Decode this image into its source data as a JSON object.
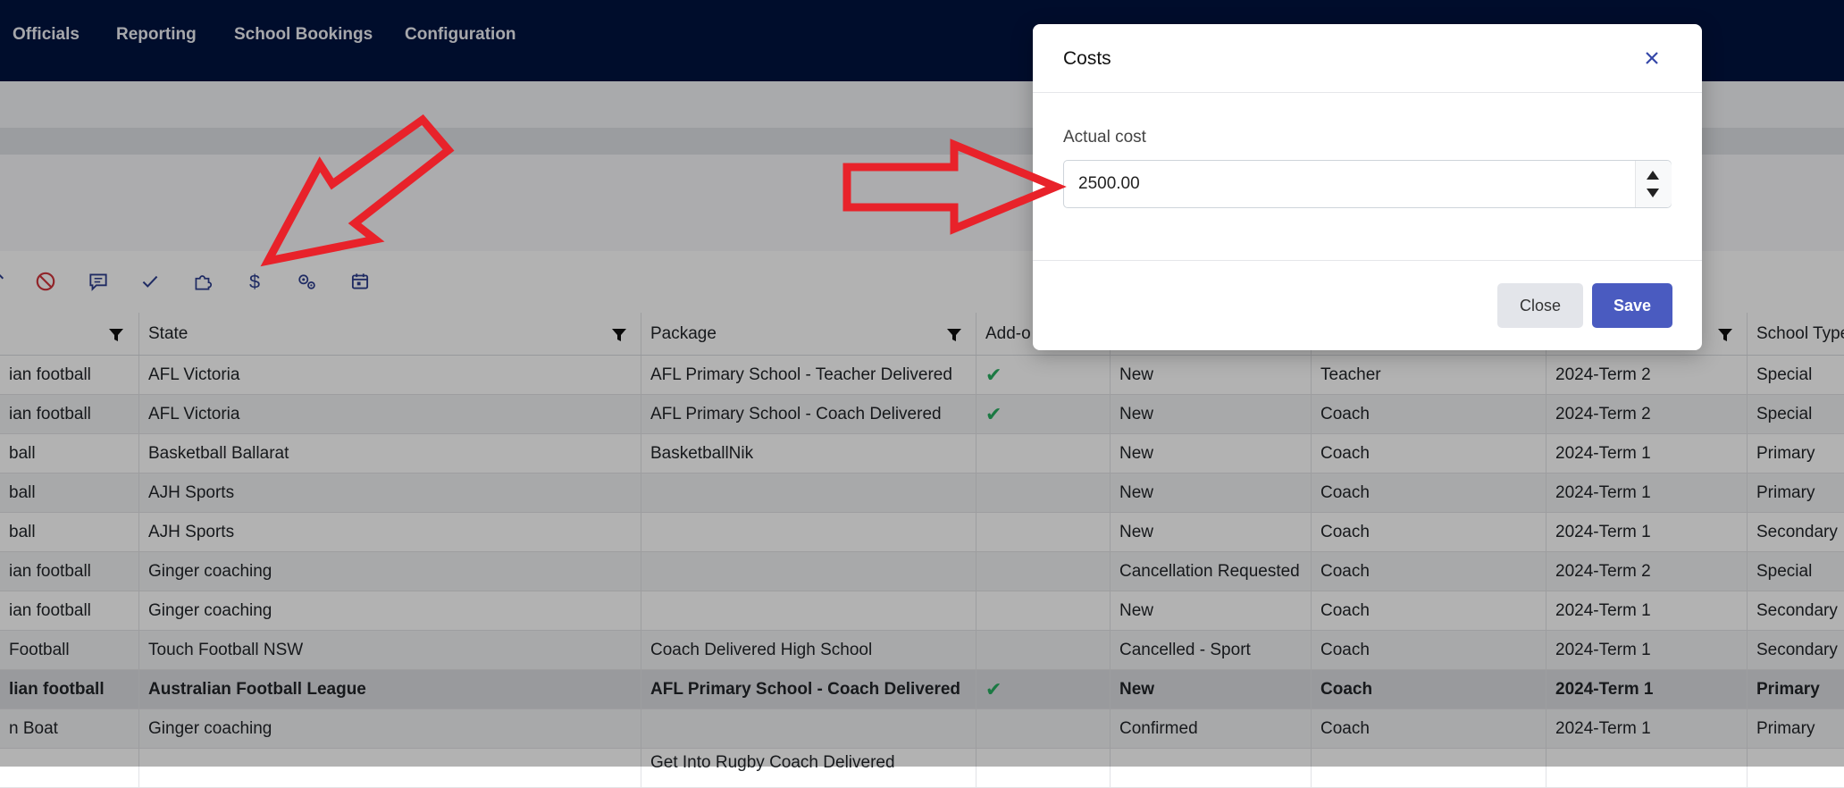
{
  "nav": {
    "items": [
      "Officials",
      "Reporting",
      "School Bookings",
      "Configuration"
    ]
  },
  "toolbar": {
    "icons": [
      "sort-icon",
      "ban-icon",
      "comment-icon",
      "check-icon",
      "puzzle-icon",
      "dollar-icon",
      "gears-icon",
      "calendar-icon"
    ]
  },
  "grid": {
    "headers": [
      "State",
      "Package",
      "Add-o",
      "School Type"
    ],
    "rows": [
      {
        "sport": "ian football",
        "state": "AFL Victoria",
        "package": "AFL Primary School - Teacher Delivered",
        "addon": true,
        "status": "New",
        "delivery": "Teacher",
        "term": "2024-Term 2",
        "school_type": "Special"
      },
      {
        "sport": "ian football",
        "state": "AFL Victoria",
        "package": "AFL Primary School - Coach Delivered",
        "addon": true,
        "status": "New",
        "delivery": "Coach",
        "term": "2024-Term 2",
        "school_type": "Special"
      },
      {
        "sport": "ball",
        "state": "Basketball Ballarat",
        "package": "BasketballNik",
        "addon": false,
        "status": "New",
        "delivery": "Coach",
        "term": "2024-Term 1",
        "school_type": "Primary"
      },
      {
        "sport": "ball",
        "state": "AJH Sports",
        "package": "",
        "addon": false,
        "status": "New",
        "delivery": "Coach",
        "term": "2024-Term 1",
        "school_type": "Primary"
      },
      {
        "sport": "ball",
        "state": "AJH Sports",
        "package": "",
        "addon": false,
        "status": "New",
        "delivery": "Coach",
        "term": "2024-Term 1",
        "school_type": "Secondary"
      },
      {
        "sport": "ian football",
        "state": "Ginger coaching",
        "package": "",
        "addon": false,
        "status": "Cancellation Requested",
        "delivery": "Coach",
        "term": "2024-Term 2",
        "school_type": "Special"
      },
      {
        "sport": "ian football",
        "state": "Ginger coaching",
        "package": "",
        "addon": false,
        "status": "New",
        "delivery": "Coach",
        "term": "2024-Term 1",
        "school_type": "Secondary"
      },
      {
        "sport": "Football",
        "state": "Touch Football NSW",
        "package": "Coach Delivered High School",
        "addon": false,
        "status": "Cancelled - Sport",
        "delivery": "Coach",
        "term": "2024-Term 1",
        "school_type": "Secondary"
      },
      {
        "sport": "lian football",
        "state": "Australian Football League",
        "package": "AFL Primary School - Coach Delivered",
        "addon": true,
        "status": "New",
        "delivery": "Coach",
        "term": "2024-Term 1",
        "school_type": "Primary",
        "selected": true
      },
      {
        "sport": "n Boat",
        "state": "Ginger coaching",
        "package": "",
        "addon": false,
        "status": "Confirmed",
        "delivery": "Coach",
        "term": "2024-Term 1",
        "school_type": "Primary"
      },
      {
        "sport": "",
        "state": "",
        "package": "Get Into Rugby Coach Delivered",
        "addon": false,
        "status": "",
        "delivery": "",
        "term": "",
        "school_type": ""
      }
    ]
  },
  "modal": {
    "title": "Costs",
    "field_label": "Actual cost",
    "field_value": "2500.00",
    "close_label": "Close",
    "save_label": "Save"
  },
  "colors": {
    "nav_bg": "#01133f",
    "primary": "#4a5bc0",
    "icon": "#2d3e8f",
    "check": "#27ae60",
    "annotation_red": "#e8222a"
  }
}
